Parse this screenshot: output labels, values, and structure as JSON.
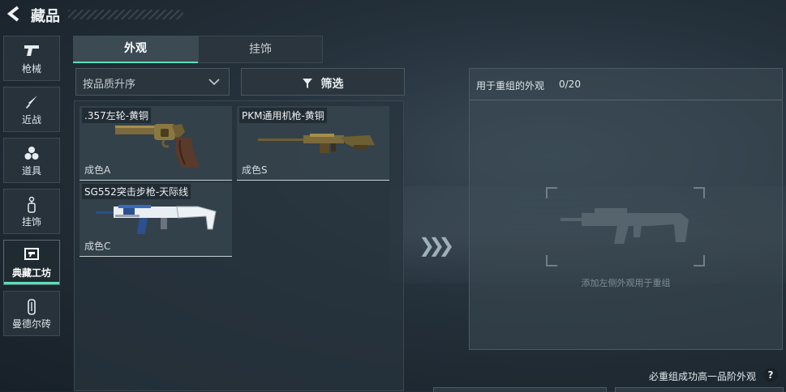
{
  "header": {
    "title": "藏品",
    "back_icon": "back-arrow-icon"
  },
  "sidebar": {
    "items": [
      {
        "label": "枪械",
        "icon": "pistol-icon",
        "active": false
      },
      {
        "label": "近战",
        "icon": "knife-icon",
        "active": false
      },
      {
        "label": "道具",
        "icon": "grenades-icon",
        "active": false
      },
      {
        "label": "挂饰",
        "icon": "charm-icon",
        "active": false
      },
      {
        "label": "典藏工坊",
        "icon": "workshop-icon",
        "active": true
      },
      {
        "label": "曼德尔砖",
        "icon": "brick-icon",
        "active": false
      }
    ]
  },
  "tabs": [
    {
      "label": "外观",
      "active": true
    },
    {
      "label": "挂饰",
      "active": false
    }
  ],
  "controls": {
    "sort_value": "按品质升序",
    "filter_label": "筛选"
  },
  "items": [
    {
      "name": ".357左轮-黄铜",
      "grade": "成色A",
      "icon": "revolver-icon"
    },
    {
      "name": "PKM通用机枪-黄铜",
      "grade": "成色S",
      "icon": "machine-gun-icon"
    },
    {
      "name": "SG552突击步枪-天际线",
      "grade": "成色C",
      "icon": "assault-rifle-icon"
    }
  ],
  "recombine": {
    "heading": "用于重组的外观",
    "count": "0/20",
    "empty_hint": "添加左侧外观用于重组",
    "slot_icon": "rifle-silhouette-icon"
  },
  "footer": {
    "note": "必重组成功高一品阶外观",
    "help": "?"
  },
  "colors": {
    "accent": "#59e0b8",
    "panel": "#2a353d"
  }
}
